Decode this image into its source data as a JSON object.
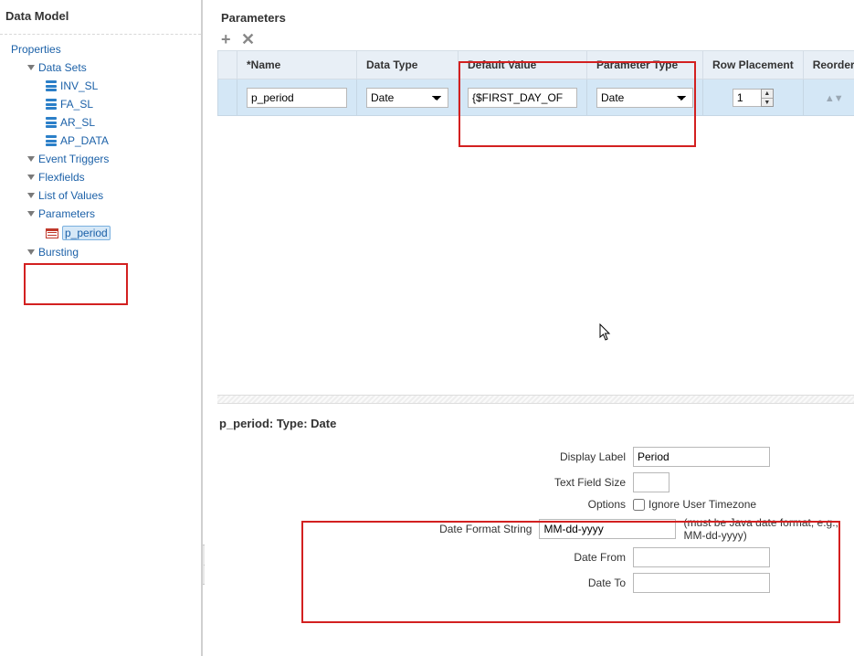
{
  "sidebar": {
    "title": "Data Model",
    "root": "Properties",
    "nodes": {
      "data_sets": "Data Sets",
      "ds_items": [
        "INV_SL",
        "FA_SL",
        "AR_SL",
        "AP_DATA"
      ],
      "event_triggers": "Event Triggers",
      "flexfields": "Flexfields",
      "list_of_values": "List of Values",
      "parameters": "Parameters",
      "param_items": [
        "p_period"
      ],
      "bursting": "Bursting"
    }
  },
  "main": {
    "title": "Parameters",
    "headers": {
      "name": "*Name",
      "data_type": "Data Type",
      "default_value": "Default Value",
      "parameter_type": "Parameter Type",
      "row_placement": "Row Placement",
      "reorder": "Reorder"
    },
    "row": {
      "name": "p_period",
      "data_type": "Date",
      "default_value": "{$FIRST_DAY_OF",
      "parameter_type": "Date",
      "row_placement": "1"
    }
  },
  "detail": {
    "title": "p_period: Type: Date",
    "labels": {
      "display_label": "Display Label",
      "text_field_size": "Text Field Size",
      "options": "Options",
      "ignore_tz": "Ignore User Timezone",
      "date_format": "Date Format String",
      "date_format_hint": "(must be Java date format, e.g., MM-dd-yyyy)",
      "date_from": "Date From",
      "date_to": "Date To"
    },
    "values": {
      "display_label": "Period",
      "text_field_size": "",
      "date_format": "MM-dd-yyyy",
      "date_from": "",
      "date_to": ""
    }
  }
}
